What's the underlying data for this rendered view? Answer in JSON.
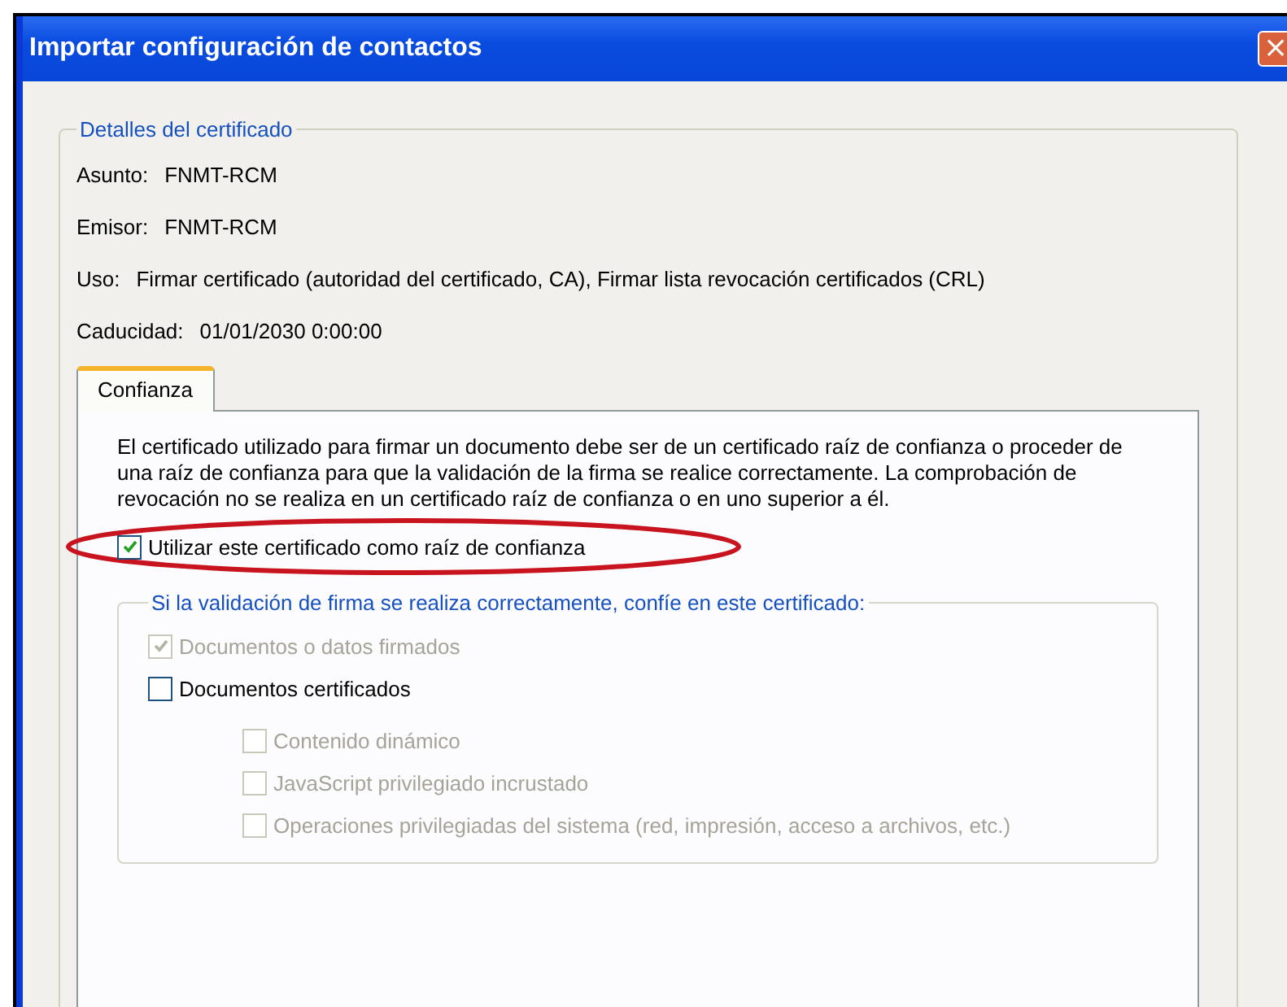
{
  "window": {
    "title": "Importar configuración de contactos",
    "close_button": "×"
  },
  "details": {
    "legend": "Detalles del certificado",
    "fields": [
      {
        "label": "Asunto:",
        "value": "FNMT-RCM"
      },
      {
        "label": "Emisor:",
        "value": "FNMT-RCM"
      },
      {
        "label": "Uso:",
        "value": "Firmar certificado (autoridad del certificado, CA), Firmar lista revocación certificados (CRL)"
      },
      {
        "label": "Caducidad:",
        "value": "01/01/2030 0:00:00"
      }
    ]
  },
  "tabs": [
    {
      "label": "Confianza",
      "selected": true
    }
  ],
  "trust": {
    "description": "El certificado utilizado para firmar un documento debe ser de un certificado raíz de confianza o proceder de una raíz de confianza para que la validación de la firma se realice correctamente. La comprobación de revocación no se realiza en un certificado raíz de confianza o en uno superior a él.",
    "root_checkbox": {
      "label": "Utilizar este certificado como raíz de confianza",
      "checked": true,
      "disabled": false
    },
    "group_legend": "Si la validación de firma se realiza correctamente, confíe en este certificado:",
    "options": [
      {
        "label": "Documentos o datos firmados",
        "checked": true,
        "disabled": true
      },
      {
        "label": "Documentos certificados",
        "checked": false,
        "disabled": false,
        "children": [
          {
            "label": "Contenido dinámico",
            "checked": false,
            "disabled": true
          },
          {
            "label": "JavaScript privilegiado incrustado",
            "checked": false,
            "disabled": true
          },
          {
            "label": "Operaciones privilegiadas del sistema (red, impresión, acceso a archivos, etc.)",
            "checked": false,
            "disabled": true
          }
        ]
      }
    ]
  }
}
